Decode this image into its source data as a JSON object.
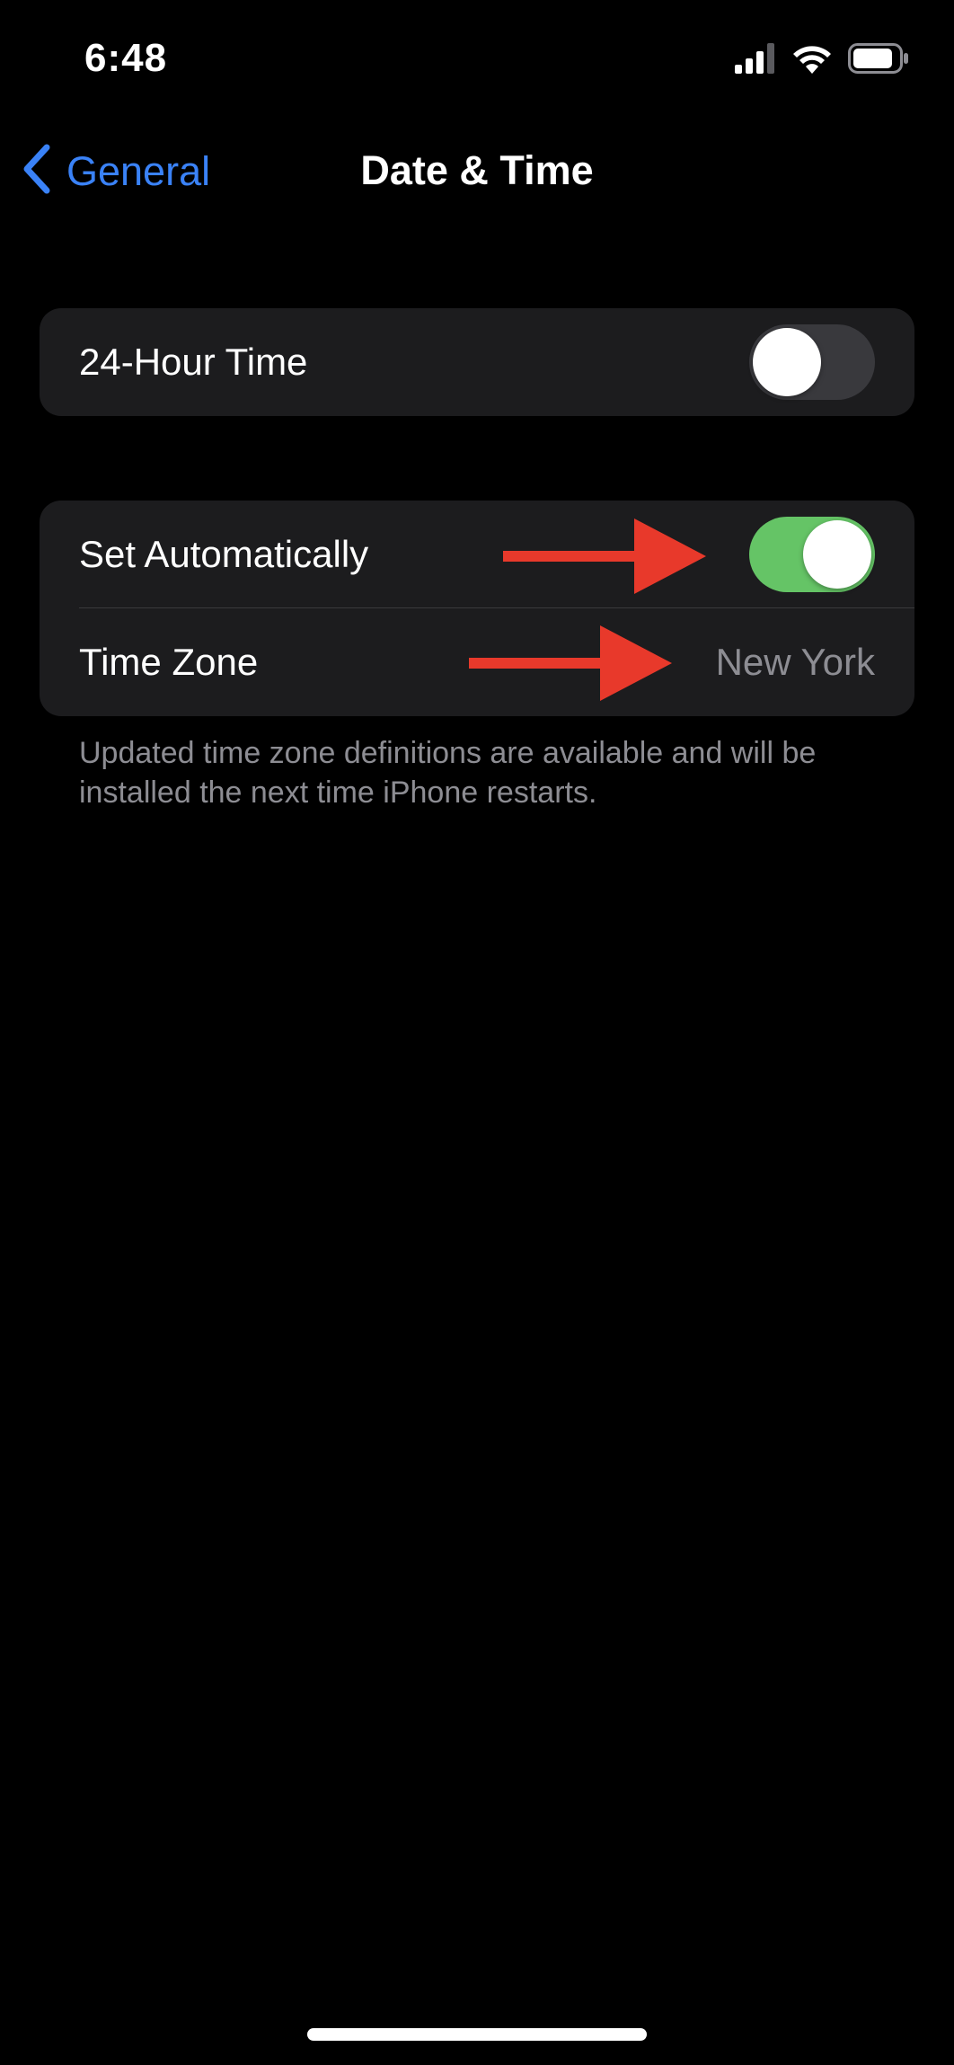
{
  "status_bar": {
    "time": "6:48",
    "icons": [
      "cellular-signal-icon",
      "wifi-icon",
      "battery-icon"
    ]
  },
  "nav": {
    "back_label": "General",
    "title": "Date & Time"
  },
  "groups": [
    {
      "rows": [
        {
          "label": "24-Hour Time",
          "toggle": "off"
        }
      ]
    },
    {
      "rows": [
        {
          "label": "Set Automatically",
          "toggle": "on"
        },
        {
          "label": "Time Zone",
          "value": "New York"
        }
      ]
    }
  ],
  "footer_note": "Updated time zone definitions are available and will be installed the next time iPhone restarts.",
  "colors": {
    "accent": "#3a82f7",
    "toggle_on": "#65c466",
    "toggle_off": "#39393d",
    "annotation_arrow": "#e8392b",
    "cell_background": "#1c1c1e"
  }
}
